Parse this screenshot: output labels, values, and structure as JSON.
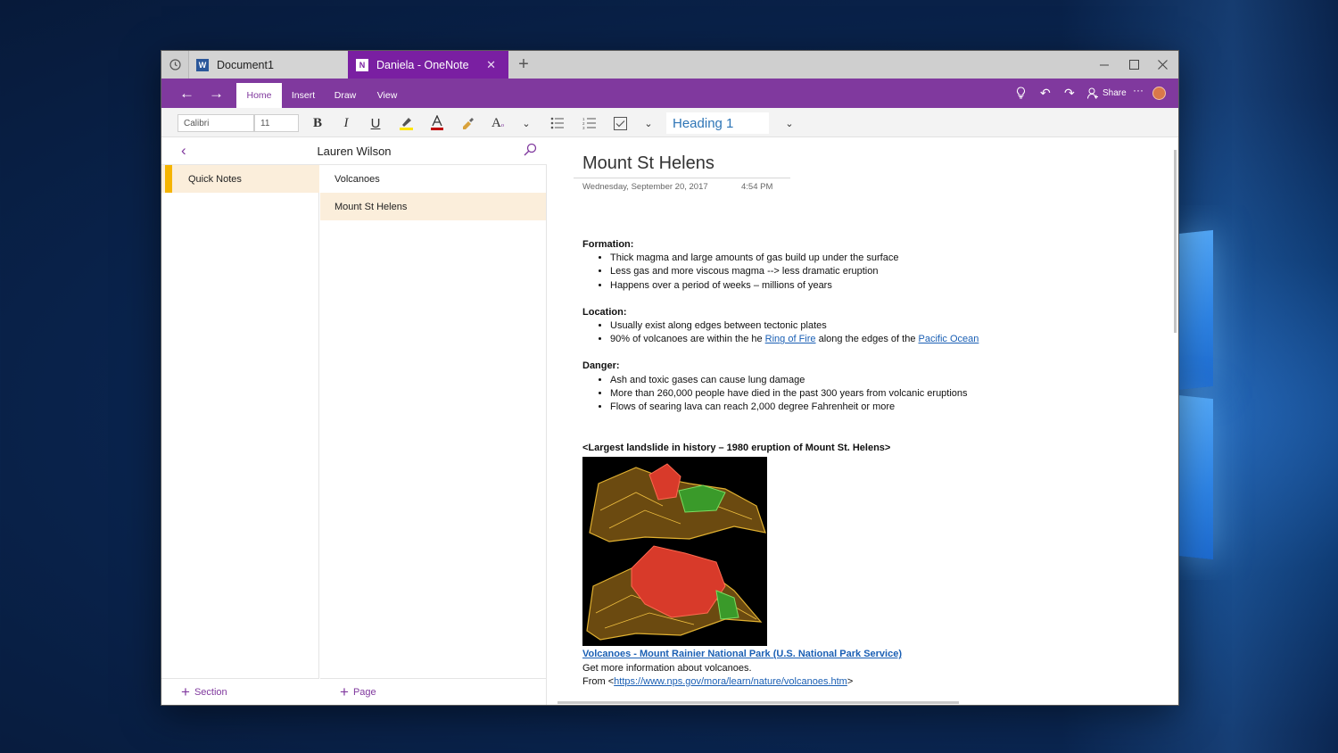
{
  "tabs": [
    {
      "label": "Document1",
      "app_icon": "word-icon"
    },
    {
      "label": "Daniela - OneNote",
      "app_icon": "onenote-icon",
      "active": true
    }
  ],
  "ribbon": {
    "tabs": [
      "Home",
      "Insert",
      "Draw",
      "View"
    ],
    "active_tab": "Home",
    "share_label": "Share",
    "more_label": "···"
  },
  "toolbar": {
    "font_name": "Calibri",
    "font_size": "11",
    "style": "Heading 1"
  },
  "notebook": {
    "owner": "Lauren Wilson",
    "sections": [
      "Quick Notes"
    ],
    "pages": [
      "Volcanoes",
      "Mount St Helens"
    ],
    "selected_page": "Mount St Helens",
    "add_section_label": "Section",
    "add_page_label": "Page"
  },
  "page": {
    "title": "Mount St Helens",
    "date": "Wednesday, September 20, 2017",
    "time": "4:54 PM",
    "formation_heading": "Formation:",
    "formation": [
      "Thick magma and large amounts of gas build up under the surface",
      "Less gas and more viscous magma --> less dramatic eruption",
      "Happens over a period of weeks – millions of years"
    ],
    "location_heading": "Location:",
    "location_1": "Usually exist along edges between tectonic plates",
    "location_2_pre": "90% of volcanoes are within the he ",
    "location_2_link1": "Ring of Fire",
    "location_2_mid": " along the edges of the ",
    "location_2_link2": "Pacific Ocean",
    "danger_heading": "Danger:",
    "danger": [
      "Ash and toxic gases can cause lung damage",
      "More than 260,000 people have died in the past 300 years from volcanic eruptions",
      "Flows of searing lava can reach 2,000 degree Fahrenheit or more"
    ],
    "image_heading": "<Largest landslide in history – 1980 eruption of Mount St. Helens>",
    "source_link": "Volcanoes - Mount Rainier National Park (U.S. National Park Service)",
    "source_desc": "Get more information about volcanoes.",
    "from_pre": "From <",
    "from_url": "https://www.nps.gov/mora/learn/nature/volcanoes.htm",
    "from_post": ">"
  },
  "colors": {
    "accent": "#80399e",
    "section_tab": "#f5b400",
    "selection": "#fbeedb",
    "link": "#1a5fb4",
    "heading_style": "#2e75b6"
  }
}
